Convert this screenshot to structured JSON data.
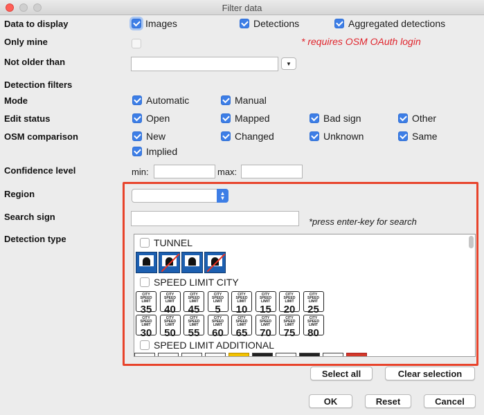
{
  "window": {
    "title": "Filter data"
  },
  "labels": {
    "data_to_display": "Data to display",
    "only_mine": "Only mine",
    "not_older_than": "Not older than",
    "detection_filters": "Detection filters",
    "mode": "Mode",
    "edit_status": "Edit status",
    "osm_comparison": "OSM comparison",
    "confidence_level": "Confidence level",
    "region": "Region",
    "search_sign": "Search sign",
    "detection_type": "Detection type"
  },
  "display": {
    "images": "Images",
    "detections": "Detections",
    "aggregated": "Aggregated detections"
  },
  "only_mine_note": "* requires OSM OAuth login",
  "not_older_than_value": "",
  "mode": {
    "automatic": "Automatic",
    "manual": "Manual"
  },
  "edit_status": {
    "open": "Open",
    "mapped": "Mapped",
    "bad_sign": "Bad sign",
    "other": "Other"
  },
  "osm": {
    "new": "New",
    "changed": "Changed",
    "unknown": "Unknown",
    "same": "Same",
    "implied": "Implied"
  },
  "confidence": {
    "min_label": "min:",
    "max_label": "max:",
    "min_value": "",
    "max_value": ""
  },
  "region_value": "",
  "search": {
    "value": "",
    "hint": "*press enter-key for search"
  },
  "detection_groups": {
    "tunnel": "TUNNEL",
    "speed_city": "SPEED LIMIT CITY",
    "speed_additional": "SPEED LIMIT ADDITIONAL"
  },
  "city_sign_caption": "CITY SPEED LIMIT",
  "city_speeds_row1": [
    "35",
    "40",
    "45",
    "5",
    "10",
    "15",
    "20",
    "25"
  ],
  "city_speeds_row2": [
    "30",
    "50",
    "55",
    "60",
    "65",
    "70",
    "75",
    "80"
  ],
  "buttons": {
    "select_all": "Select all",
    "clear_selection": "Clear selection",
    "ok": "OK",
    "reset": "Reset",
    "cancel": "Cancel"
  },
  "colors": {
    "accent": "#3d7ee6",
    "warning": "#e0232b",
    "highlight": "#e8432b"
  }
}
